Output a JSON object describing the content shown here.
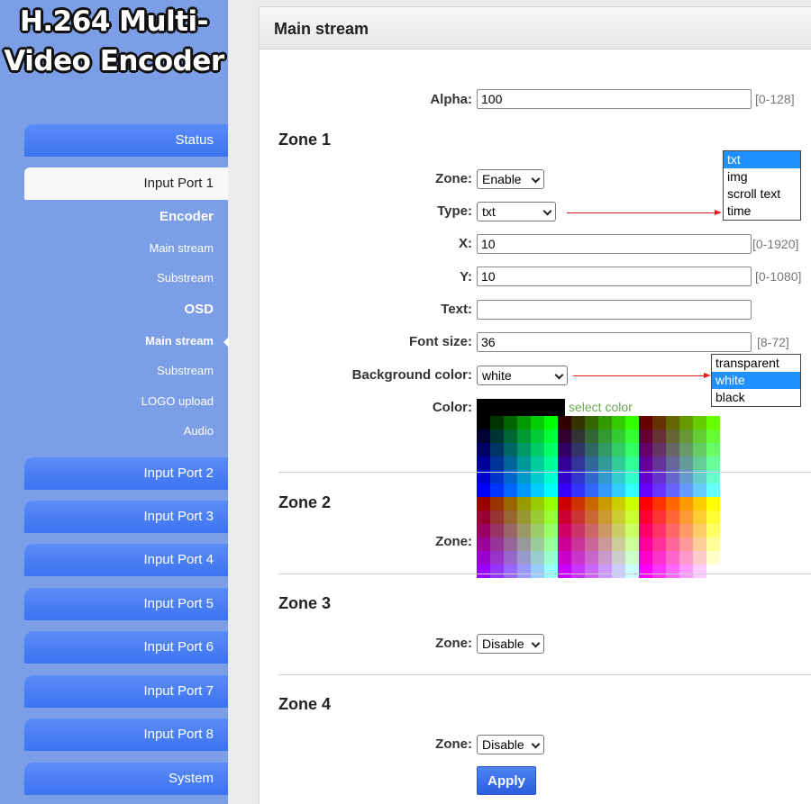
{
  "logo": {
    "line1": "H.264 Multi-",
    "line2": "Video Encoder"
  },
  "sidebar": {
    "status": "Status",
    "input_port_1": "Input Port 1",
    "encoder": "Encoder",
    "encoder_main": "Main stream",
    "encoder_sub": "Substream",
    "osd": "OSD",
    "osd_main": "Main stream",
    "osd_sub": "Substream",
    "logo_upload": "LOGO upload",
    "audio": "Audio",
    "ports": [
      "Input Port 2",
      "Input Port 3",
      "Input Port 4",
      "Input Port 5",
      "Input Port 6",
      "Input Port 7",
      "Input Port 8"
    ],
    "system": "System"
  },
  "panel": {
    "title": "Main stream",
    "alpha": {
      "label": "Alpha:",
      "value": "100",
      "range": "[0-128]"
    },
    "zone1": {
      "title": "Zone 1",
      "zone_label": "Zone:",
      "zone_value": "Enable",
      "type_label": "Type:",
      "type_value": "txt",
      "type_options": [
        "txt",
        "img",
        "scroll text",
        "time"
      ],
      "x_label": "X:",
      "x_value": "10",
      "x_range": "[0-1920]",
      "y_label": "Y:",
      "y_value": "10",
      "y_range": "[0-1080]",
      "text_label": "Text:",
      "text_value": "",
      "font_label": "Font size:",
      "font_value": "36",
      "font_range": "[8-72]",
      "bg_label": "Background color:",
      "bg_value": "white",
      "bg_options": [
        "transparent",
        "white",
        "black"
      ],
      "color_label": "Color:",
      "color_value": "#000000",
      "select_color": "select color"
    },
    "zone2": {
      "title": "Zone 2",
      "zone_label": "Zone:"
    },
    "zone3": {
      "title": "Zone 3",
      "zone_label": "Zone:",
      "zone_value": "Disable"
    },
    "zone4": {
      "title": "Zone 4",
      "zone_label": "Zone:",
      "zone_value": "Disable"
    },
    "apply": "Apply"
  },
  "colors": {
    "sidebar_bg": "#7c9ee6",
    "nav_button": "#4a7ff4",
    "accent": "#1e90ff",
    "annotation_arrow": "#e02020",
    "select_color_link": "#6aa84f"
  }
}
